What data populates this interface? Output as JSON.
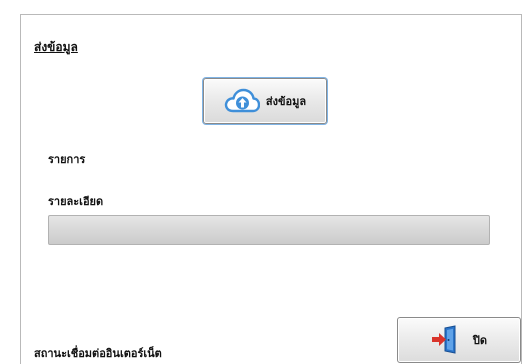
{
  "section": {
    "title": "ส่งข้อมูล"
  },
  "send_button": {
    "label": "ส่งข้อมูล",
    "icon": "cloud-upload-icon"
  },
  "item": {
    "label": "รายการ"
  },
  "detail": {
    "label": "รายละเอียด"
  },
  "progress": {
    "percent": 0
  },
  "status": {
    "label": "สถานะเชื่อมต่ออินเตอร์เน็ต"
  },
  "close_button": {
    "label": "ปิด",
    "icon": "exit-door-icon"
  },
  "colors": {
    "cloud": "#3f8fd9",
    "door": "#2a74c9",
    "arrow": "#d9342b"
  }
}
